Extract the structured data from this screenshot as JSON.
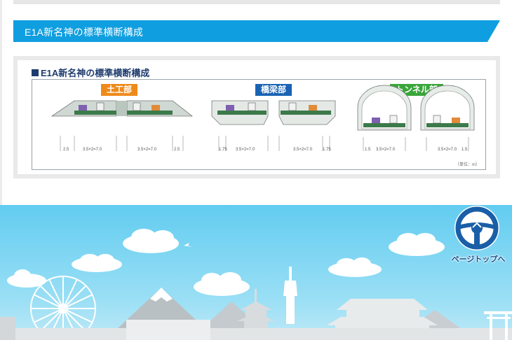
{
  "section": {
    "heading": "E1A新名神の標準横断構成"
  },
  "figure": {
    "title": "E1A新名神の標準横断構成",
    "sections": [
      {
        "label": "土工部",
        "color": "#ef8a1a",
        "dims": [
          "2.5",
          "3.5×2=7.0",
          "3.5×2=7.0",
          "2.5"
        ]
      },
      {
        "label": "橋梁部",
        "color": "#1a63b4",
        "dims": [
          "1.75",
          "3.5×2=7.0",
          "3.5×2=7.0",
          "1.75"
        ]
      },
      {
        "label": "トンネル部",
        "color": "#3aa63a",
        "dims": [
          "1.5",
          "3.5×2=7.0",
          "3.5×2=7.0",
          "1.5"
        ]
      }
    ],
    "unit_note": "（単位：m）"
  },
  "pagetop": {
    "label": "ページトップへ",
    "icon": "steering-wheel-icon",
    "color": "#1a5ea8"
  },
  "colors": {
    "heading_bar": "#0f9ee0",
    "sky": "#62ccf0"
  }
}
